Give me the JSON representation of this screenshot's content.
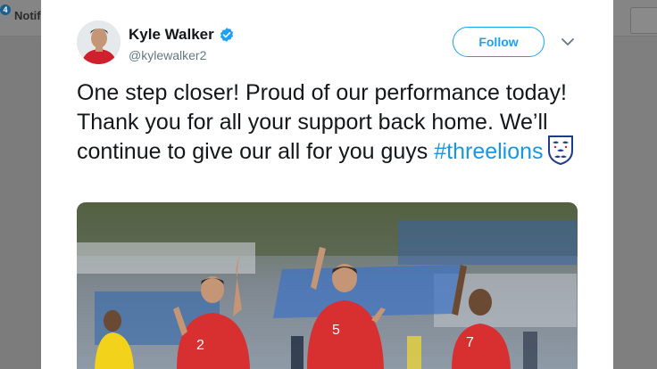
{
  "background": {
    "notifications_label": "Notifi",
    "notifications_count": "4"
  },
  "tweet": {
    "author": {
      "display_name": "Kyle Walker",
      "handle": "@kylewalker2",
      "verified": true
    },
    "follow_label": "Follow",
    "text_parts": {
      "body": "One step closer! Proud of our performance today! Thank you for all your support back home. We’ll continue to give our all for you guys ",
      "hashtag": "#threelions"
    },
    "icons": {
      "verified": "verified-badge-icon",
      "more": "chevron-down-icon",
      "emoji": "england-crest-emoji"
    },
    "media": {
      "shirt_numbers": [
        "2",
        "5",
        "7"
      ]
    }
  },
  "colors": {
    "accent": "#1da1f2",
    "hashtag": "#1b95e0",
    "text": "#14171a",
    "secondary_text": "#657786",
    "overlay": "#7f7f7f"
  }
}
